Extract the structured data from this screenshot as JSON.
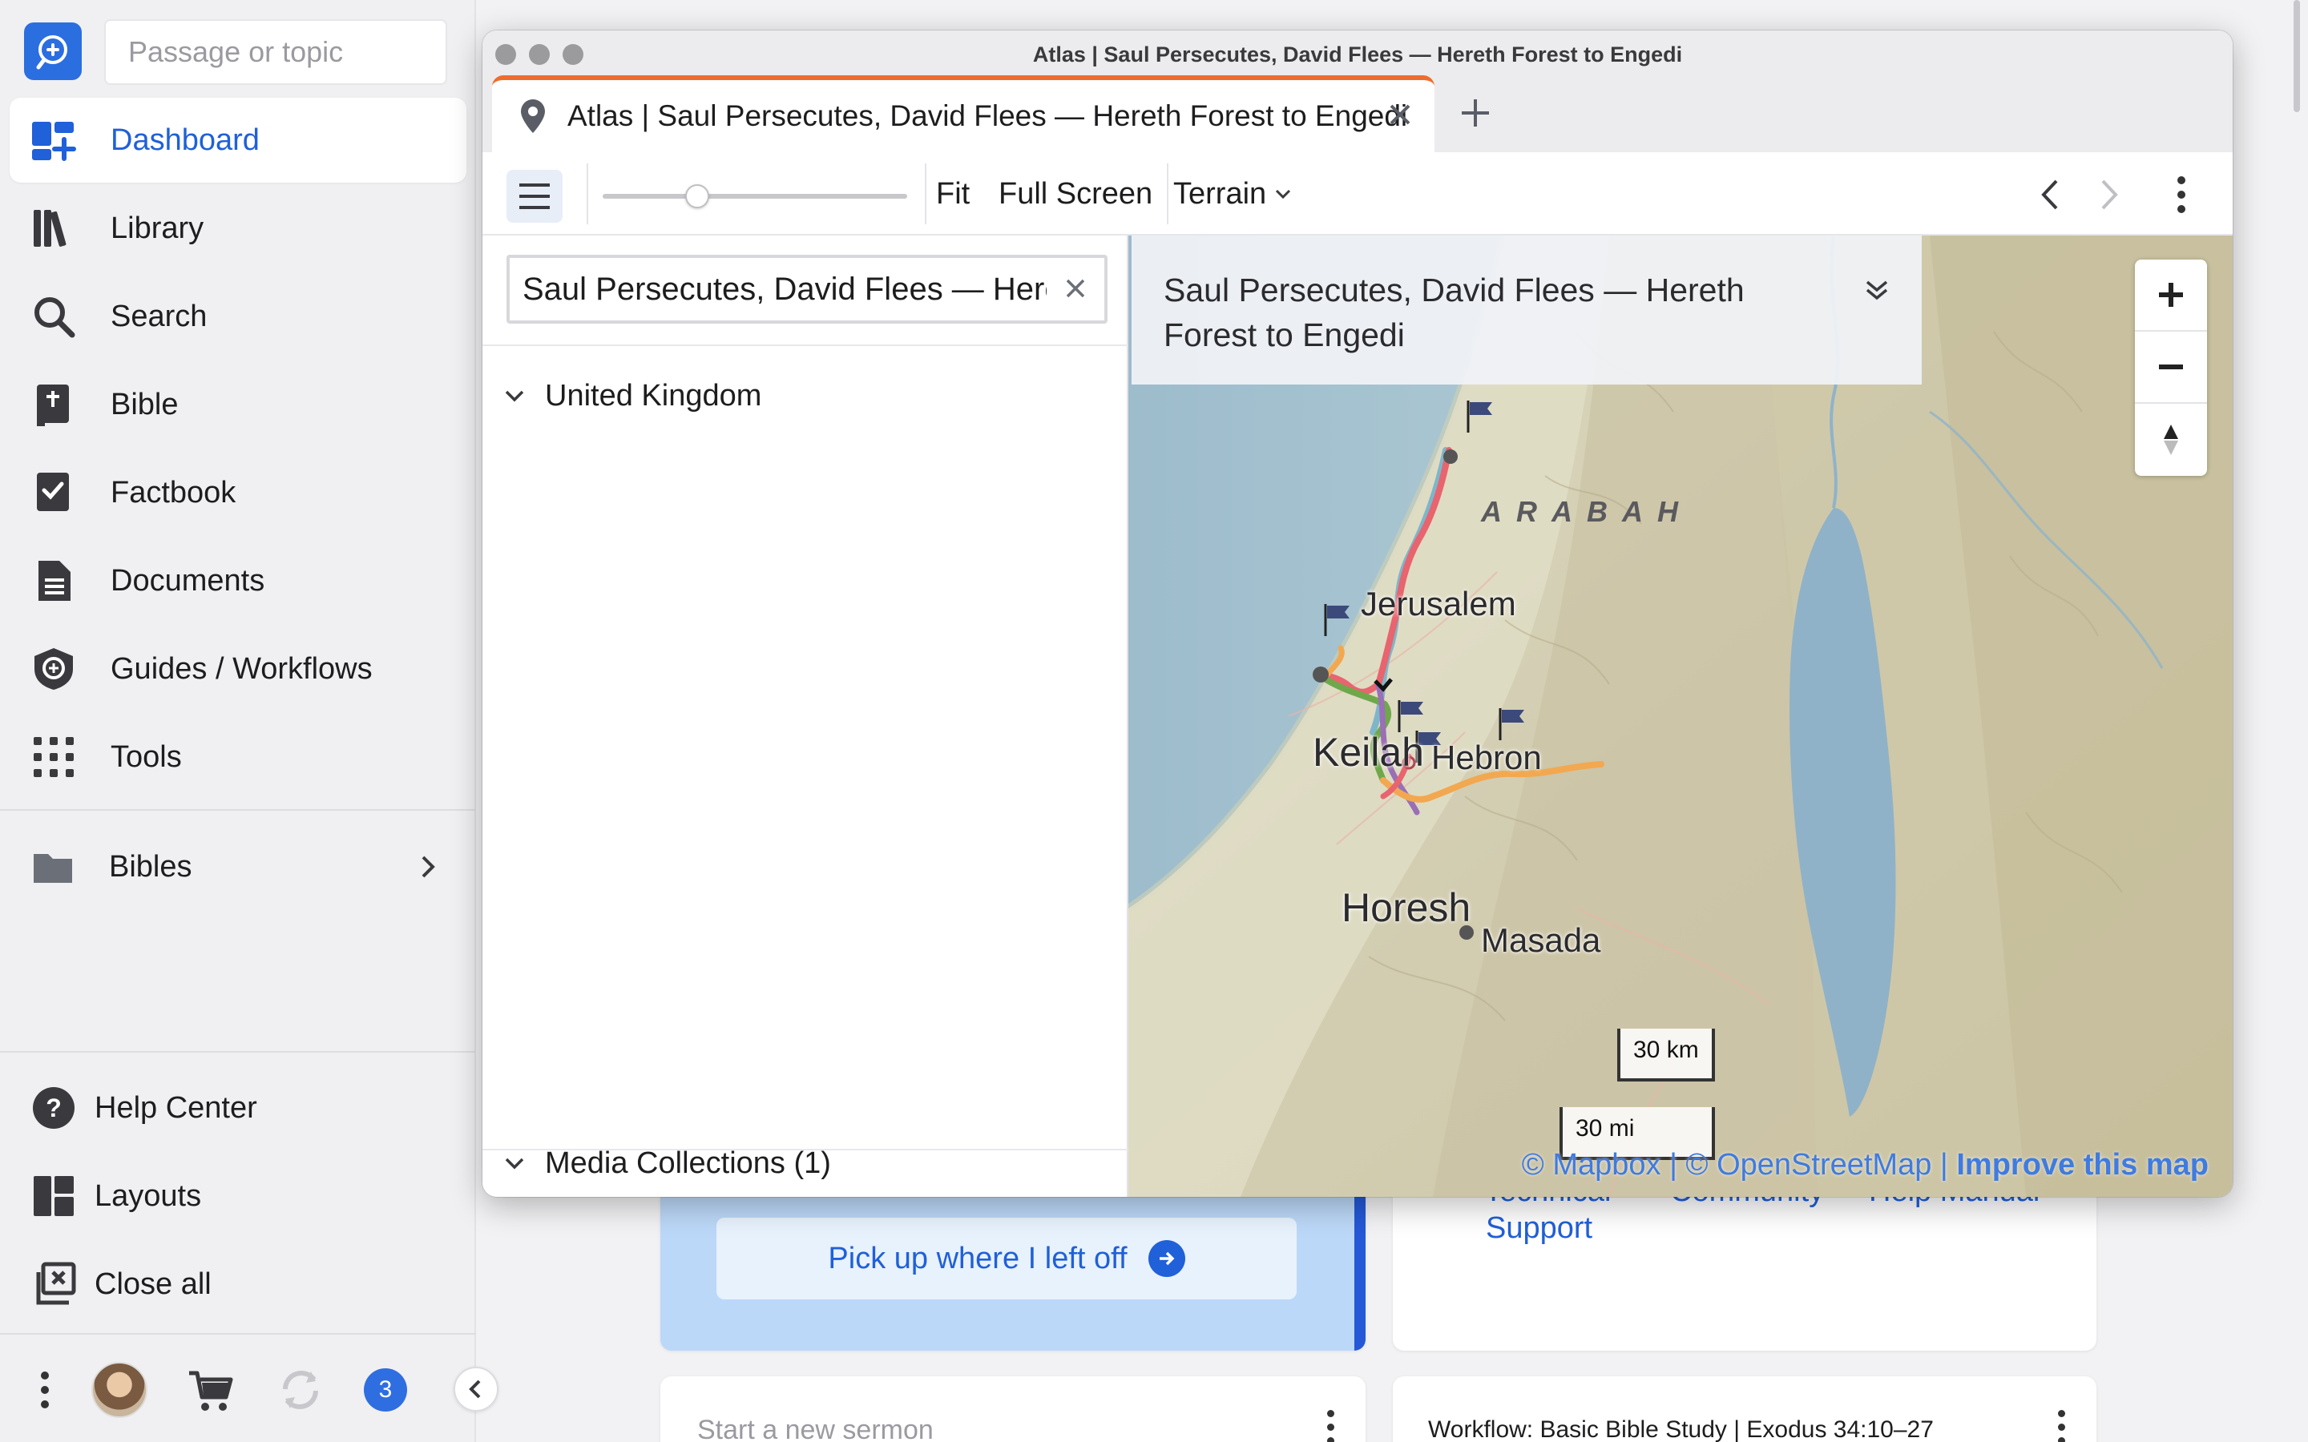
{
  "sidebar": {
    "search_placeholder": "Passage or topic",
    "nav": [
      {
        "label": "Dashboard",
        "icon": "dashboard-icon",
        "active": true
      },
      {
        "label": "Library",
        "icon": "library-icon"
      },
      {
        "label": "Search",
        "icon": "search-icon"
      },
      {
        "label": "Bible",
        "icon": "bible-icon"
      },
      {
        "label": "Factbook",
        "icon": "factbook-icon"
      },
      {
        "label": "Documents",
        "icon": "documents-icon"
      },
      {
        "label": "Guides / Workflows",
        "icon": "guides-icon"
      },
      {
        "label": "Tools",
        "icon": "tools-icon"
      }
    ],
    "bibles_label": "Bibles",
    "bottom_nav": [
      {
        "label": "Help Center",
        "icon": "help-icon"
      },
      {
        "label": "Layouts",
        "icon": "layouts-icon"
      },
      {
        "label": "Close all",
        "icon": "close-all-icon"
      }
    ],
    "notification_count": "3",
    "accent": "#2060d8"
  },
  "dashboard": {
    "pickup_label": "Pick up where I left off",
    "support_links": [
      "Technical",
      "Community",
      "Help Manual",
      "Support"
    ],
    "new_sermon_placeholder": "Start a new sermon",
    "workflow_title": "Workflow: Basic Bible Study | Exodus 34:10–27"
  },
  "window": {
    "title": "Atlas | Saul Persecutes, David Flees — Hereth Forest to Engedi",
    "tab_label": "Atlas | Saul Persecutes, David Flees — Hereth Forest to Engedi",
    "tab_accent": "#ee6d2e",
    "toolbar": {
      "fit_label": "Fit",
      "fullscreen_label": "Full Screen",
      "terrain_label": "Terrain",
      "zoom_fraction": 0.31
    },
    "left_panel": {
      "search_value": "Saul Persecutes, David Flees — Hereth Forest to Engedi",
      "tree": [
        {
          "label": "United Kingdom"
        },
        {
          "label": "Media Collections (1)"
        }
      ]
    },
    "map": {
      "title": "Saul Persecutes, David Flees — Hereth Forest to Engedi",
      "region": "ARABAH",
      "places": [
        "Jerusalem",
        "Keilah",
        "Hebron",
        "Horesh",
        "Masada"
      ],
      "scale_km": "30 km",
      "scale_mi": "30 mi",
      "attribution": {
        "mapbox": "© Mapbox",
        "separator": "|",
        "osm": "© OpenStreetMap",
        "improve": "Improve this map"
      },
      "route_colors": [
        "#e8646e",
        "#7eb6c9",
        "#f2a850",
        "#6fa84a",
        "#9a6fb5"
      ]
    }
  }
}
